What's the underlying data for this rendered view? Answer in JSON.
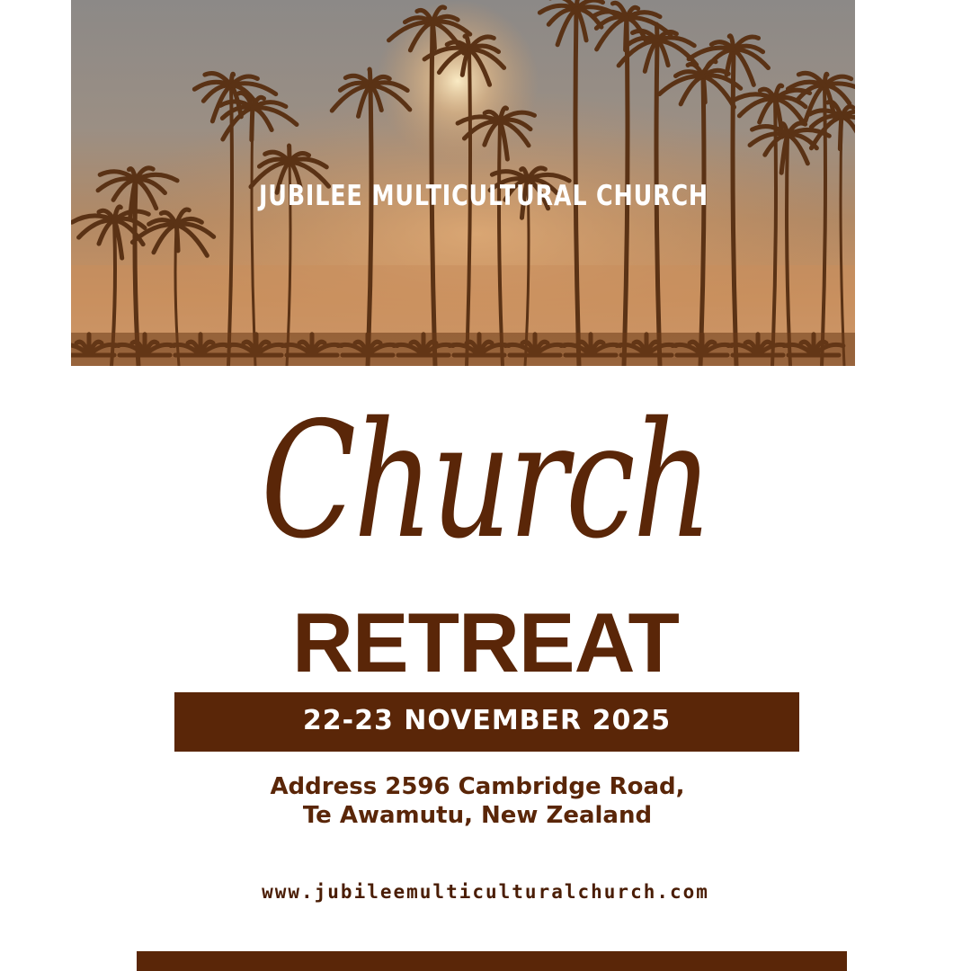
{
  "header": {
    "church_name": "JUBILEE MULTICULTURAL CHURCH",
    "hero_image": "sunset-palm-trees-photo"
  },
  "title": {
    "script_word": "Church",
    "main_word": "RETREAT"
  },
  "event": {
    "date": "22-23 NOVEMBER 2025"
  },
  "address": {
    "line1": "Address 2596 Cambridge Road,",
    "line2": "Te Awamutu, New Zealand"
  },
  "footer": {
    "website": "www.jubileemulticulturalchurch.com"
  },
  "colors": {
    "brand_brown": "#5a2608",
    "hero_overlay": "#808080",
    "background": "#ffffff"
  }
}
